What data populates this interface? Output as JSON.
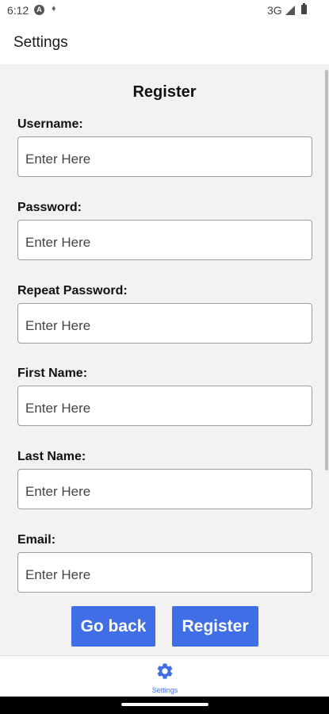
{
  "status_bar": {
    "time": "6:12",
    "network": "3G"
  },
  "app_bar": {
    "title": "Settings"
  },
  "form": {
    "title": "Register",
    "fields": [
      {
        "label": "Username:",
        "placeholder": "Enter Here",
        "value": ""
      },
      {
        "label": "Password:",
        "placeholder": "Enter Here",
        "value": ""
      },
      {
        "label": "Repeat Password:",
        "placeholder": "Enter Here",
        "value": ""
      },
      {
        "label": "First Name:",
        "placeholder": "Enter Here",
        "value": ""
      },
      {
        "label": "Last Name:",
        "placeholder": "Enter Here",
        "value": ""
      },
      {
        "label": "Email:",
        "placeholder": "Enter Here",
        "value": ""
      }
    ],
    "go_back_label": "Go back",
    "register_label": "Register"
  },
  "bottom_nav": {
    "items": [
      {
        "label": "Settings",
        "icon": "gear-icon",
        "active": true
      }
    ]
  },
  "colors": {
    "accent": "#3f6ee6",
    "content_background": "#f2f2f2"
  }
}
